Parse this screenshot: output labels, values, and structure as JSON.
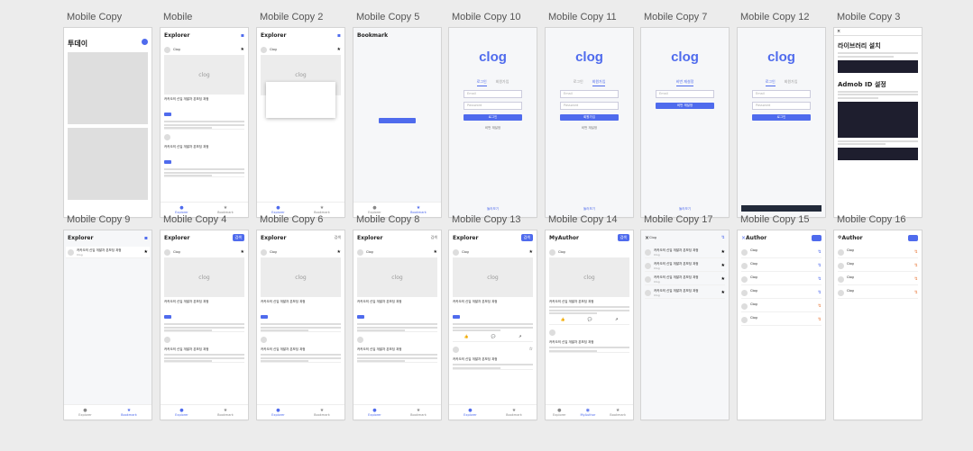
{
  "frames": [
    {
      "label": "Mobile Copy"
    },
    {
      "label": "Mobile"
    },
    {
      "label": "Mobile Copy 2"
    },
    {
      "label": "Mobile Copy 5"
    },
    {
      "label": "Mobile Copy 10"
    },
    {
      "label": "Mobile Copy 11"
    },
    {
      "label": "Mobile Copy 7"
    },
    {
      "label": "Mobile Copy 12"
    },
    {
      "label": "Mobile Copy 3"
    },
    {
      "label": "Mobile Copy 9"
    },
    {
      "label": "Mobile Copy 4"
    },
    {
      "label": "Mobile Copy 6"
    },
    {
      "label": "Mobile Copy 8"
    },
    {
      "label": "Mobile Copy 13"
    },
    {
      "label": "Mobile Copy 14"
    },
    {
      "label": "Mobile Copy 17"
    },
    {
      "label": "Mobile Copy 15"
    },
    {
      "label": "Mobile Copy 16"
    }
  ],
  "screen_text": {
    "today_title": "투데이",
    "explorer": "Explorer",
    "bookmark": "Bookmark",
    "myauthor": "MyAuthor",
    "author": "Author",
    "library_title": "라이브러리 설치",
    "admob_title": "Admob ID 설정",
    "logo": "clog",
    "card_title_1": "카카오의 신입 개발자 온보딩 과정",
    "card_title_2": "카카오의 신입 개발자 온보딩 과정",
    "author_name": "Clog",
    "tab_explorer": "Explorer",
    "tab_bookmark": "Bookmark",
    "tab_myauthor": "MyAuthor",
    "email": "Email",
    "password": "Password",
    "login": "로그인",
    "signup": "회원가입",
    "search": "검색",
    "password_find": "비번 재설정",
    "bottom_link": "둘러보기"
  },
  "accent": "#4f6bed"
}
